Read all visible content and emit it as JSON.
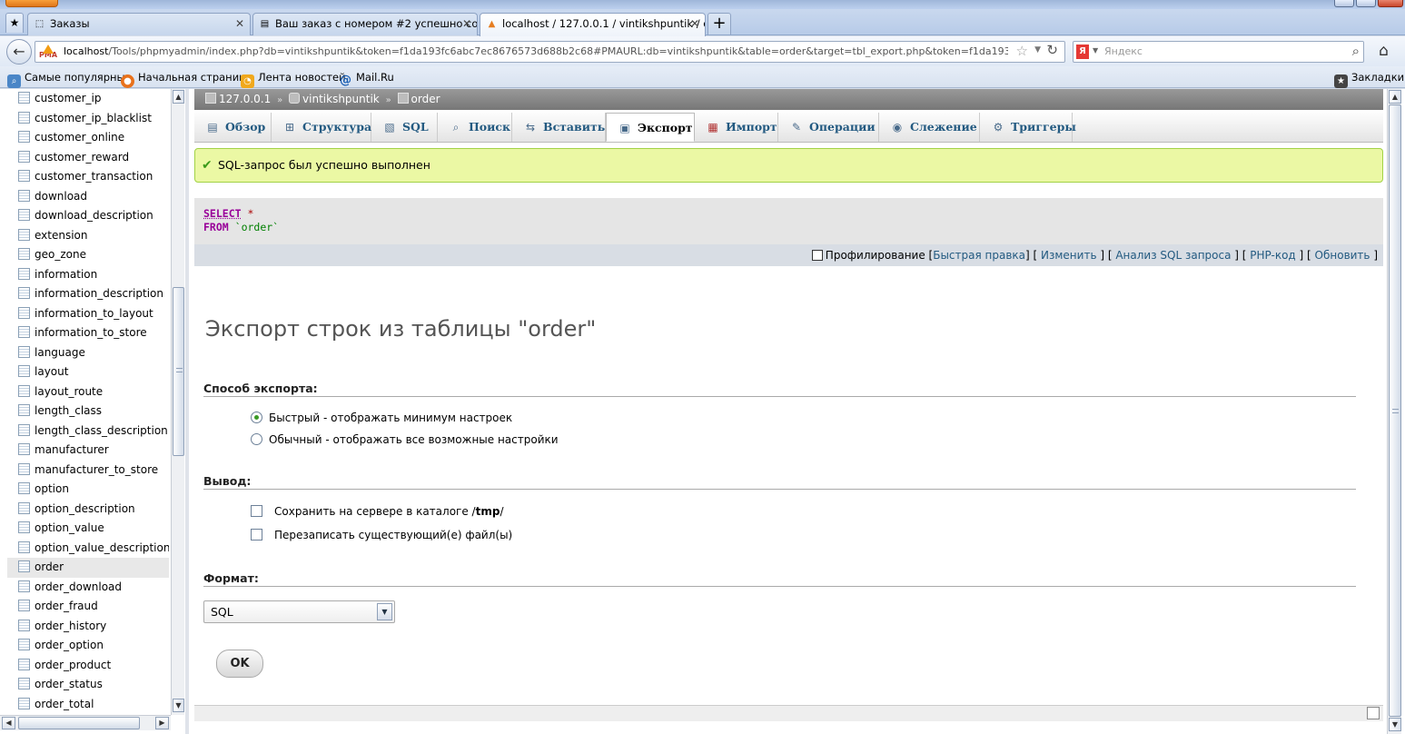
{
  "browser": {
    "tabs": [
      {
        "title": "Заказы"
      },
      {
        "title": "Ваш заказ с номером #2 успешно созд..."
      },
      {
        "title": "localhost / 127.0.0.1 / vintikshpuntik / or..."
      }
    ],
    "new_tab_label": "+",
    "url_host": "localhost",
    "url_rest": "/Tools/phpmyadmin/index.php?db=vintikshpuntik&token=f1da193fc6abc7ec8676573d688b2c68#PMAURL:db=vintikshpuntik&table=order&target=tbl_export.php&token=f1da193fc6abc7ec8676573d688b2c6",
    "url_favicon_label": "PMA",
    "search_engine_label": "Я",
    "search_placeholder": "Яндекс",
    "bookmarks": [
      "Самые популярные",
      "Начальная страница",
      "Лента новостей",
      "Mail.Ru"
    ],
    "bookmarks_menu": "Закладки"
  },
  "sidebar": {
    "tables": [
      "customer_ip",
      "customer_ip_blacklist",
      "customer_online",
      "customer_reward",
      "customer_transaction",
      "download",
      "download_description",
      "extension",
      "geo_zone",
      "information",
      "information_description",
      "information_to_layout",
      "information_to_store",
      "language",
      "layout",
      "layout_route",
      "length_class",
      "length_class_description",
      "manufacturer",
      "manufacturer_to_store",
      "option",
      "option_description",
      "option_value",
      "option_value_description",
      "order",
      "order_download",
      "order_fraud",
      "order_history",
      "order_option",
      "order_product",
      "order_status",
      "order_total"
    ],
    "selected": "order"
  },
  "breadcrumb": {
    "server": "127.0.0.1",
    "sep": "»",
    "database": "vintikshpuntik",
    "table": "order"
  },
  "menu": {
    "tabs": [
      "Обзор",
      "Структура",
      "SQL",
      "Поиск",
      "Вставить",
      "Экспорт",
      "Импорт",
      "Операции",
      "Слежение",
      "Триггеры"
    ],
    "active": "Экспорт"
  },
  "message": {
    "success": "SQL-запрос был успешно выполнен"
  },
  "sql": {
    "select_kw": "SELECT",
    "star": "*",
    "from_kw": "FROM",
    "table": "`order`"
  },
  "sql_actions": {
    "profiling": "Профилирование",
    "quick_edit": "Быстрая правка",
    "edit": "Изменить",
    "explain": "Анализ SQL запроса",
    "php_code": "PHP-код",
    "refresh": "Обновить"
  },
  "export": {
    "title": "Экспорт строк из таблицы \"order\"",
    "method_heading": "Способ экспорта:",
    "method_quick": "Быстрый - отображать минимум настроек",
    "method_custom": "Обычный - отображать все возможные настройки",
    "method_selected": "quick",
    "output_heading": "Вывод:",
    "save_on_server_prefix": "Сохранить на сервере в каталоге /",
    "save_on_server_dir": "tmp",
    "save_on_server_suffix": "/",
    "overwrite": "Перезаписать существующий(е) файл(ы)",
    "format_heading": "Формат:",
    "format_value": "SQL",
    "ok_label": "OK"
  }
}
